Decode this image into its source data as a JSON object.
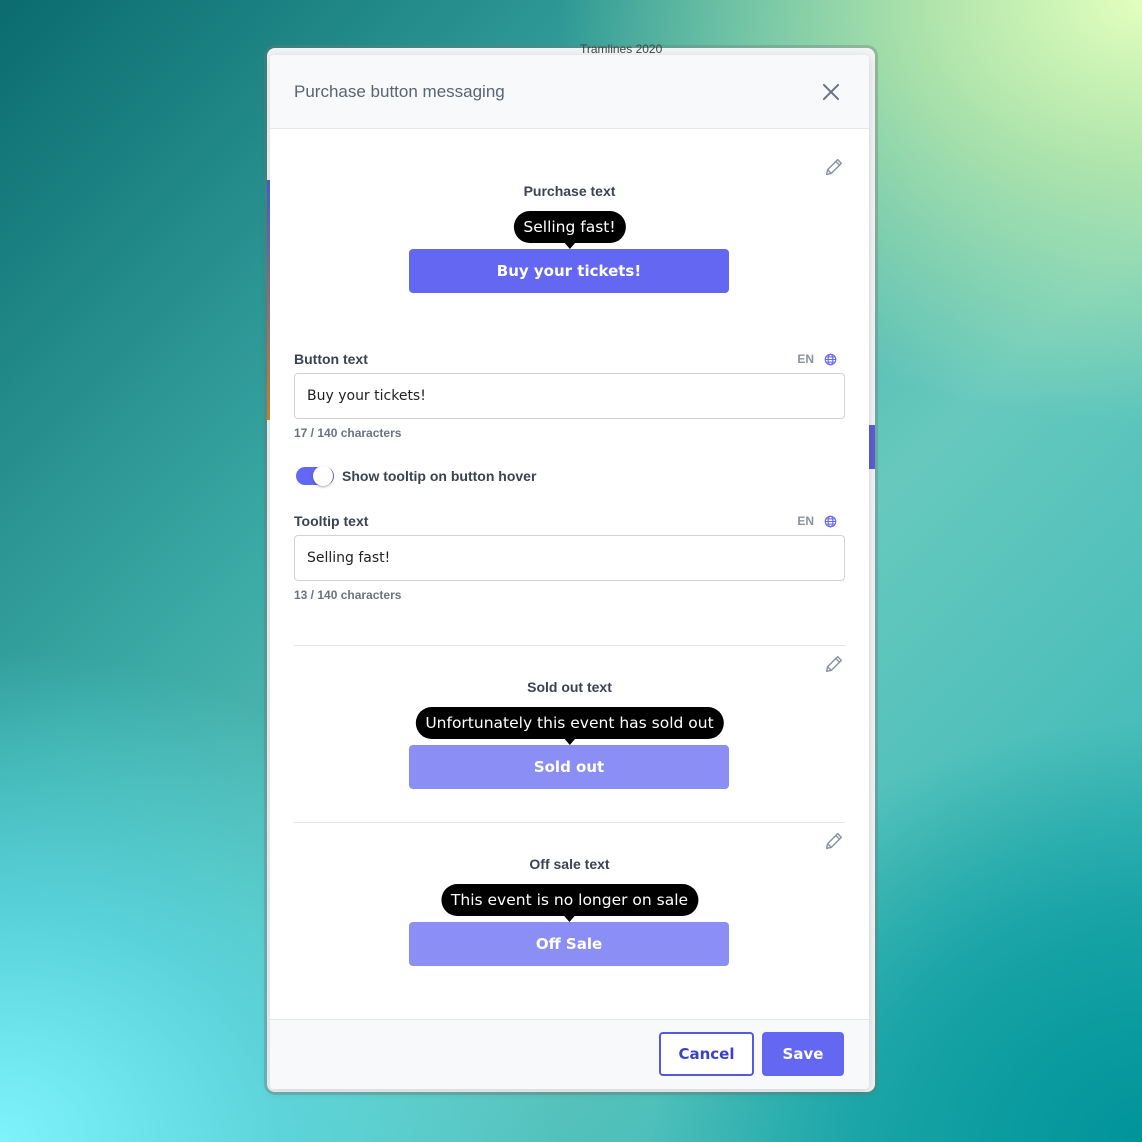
{
  "backdrop": {
    "page_title": "Tramlines 2020"
  },
  "modal": {
    "title": "Purchase button messaging",
    "close_icon": "close-icon"
  },
  "purchase": {
    "section_label": "Purchase text",
    "tooltip_preview": "Selling fast!",
    "button_preview": "Buy your tickets!",
    "edit_icon": "pencil-icon"
  },
  "button_text_field": {
    "label": "Button text",
    "lang": "EN",
    "value": "Buy your tickets!",
    "char_count": "17 / 140 characters"
  },
  "tooltip_toggle": {
    "label": "Show tooltip on button hover",
    "enabled": true
  },
  "tooltip_text_field": {
    "label": "Tooltip text",
    "lang": "EN",
    "value": "Selling fast!",
    "char_count": "13 / 140 characters"
  },
  "sold_out": {
    "section_label": "Sold out text",
    "tooltip_preview": "Unfortunately this event has sold out",
    "button_preview": "Sold out",
    "edit_icon": "pencil-icon"
  },
  "off_sale": {
    "section_label": "Off sale text",
    "tooltip_preview": "This event is no longer on sale",
    "button_preview": "Off Sale",
    "edit_icon": "pencil-icon"
  },
  "footer": {
    "cancel_label": "Cancel",
    "save_label": "Save"
  },
  "colors": {
    "accent": "#6467f2",
    "accent_muted": "#8b8ef5",
    "tooltip_bg": "#000000"
  }
}
